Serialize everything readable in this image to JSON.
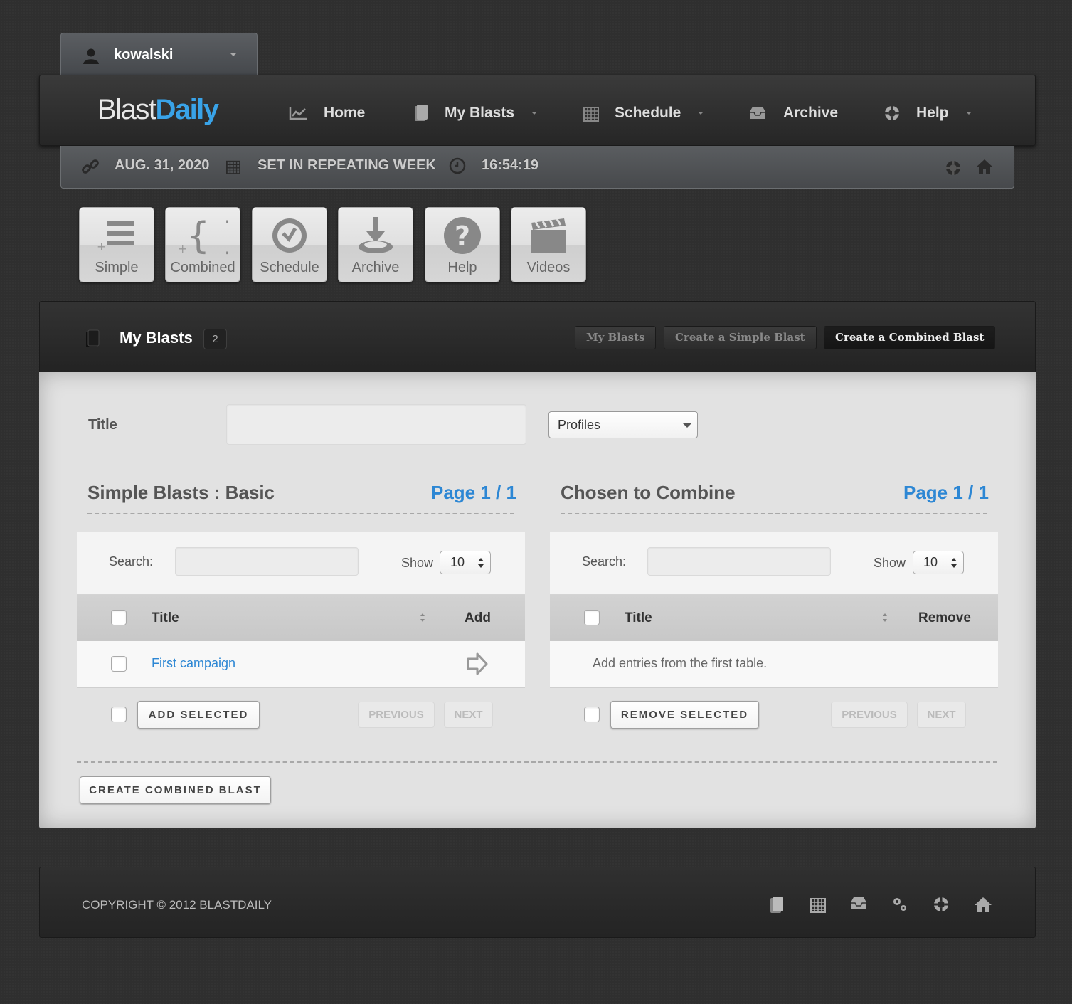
{
  "user": {
    "name": "kowalski"
  },
  "brand": {
    "part1": "Blast",
    "part2": "Daily",
    "accent": "#39a3e8"
  },
  "nav": {
    "home": "Home",
    "my_blasts": "My Blasts",
    "schedule": "Schedule",
    "archive": "Archive",
    "help": "Help"
  },
  "infobar": {
    "date": "AUG. 31, 2020",
    "week": "SET IN REPEATING WEEK",
    "time": "16:54:19"
  },
  "quick": {
    "simple": "Simple",
    "combined": "Combined",
    "schedule": "Schedule",
    "archive": "Archive",
    "help": "Help",
    "videos": "Videos"
  },
  "panel": {
    "title": "My Blasts",
    "count": "2",
    "btn_my_blasts": "My Blasts",
    "btn_simple": "Create a Simple Blast",
    "btn_combined": "Create a Combined Blast"
  },
  "form": {
    "title_label": "Title",
    "title_value": "",
    "profiles": "Profiles"
  },
  "left_table": {
    "section": "Simple Blasts : Basic",
    "page": "Page 1 / 1",
    "search_label": "Search:",
    "show_label": "Show",
    "show_value": "10",
    "col_title": "Title",
    "col_action": "Add",
    "rows": [
      {
        "title": "First campaign"
      }
    ],
    "action_button": "ADD SELECTED",
    "prev": "PREVIOUS",
    "next": "NEXT"
  },
  "right_table": {
    "section": "Chosen to Combine",
    "page": "Page 1 / 1",
    "search_label": "Search:",
    "show_label": "Show",
    "show_value": "10",
    "col_title": "Title",
    "col_action": "Remove",
    "empty": "Add entries from the first table.",
    "action_button": "REMOVE SELECTED",
    "prev": "PREVIOUS",
    "next": "NEXT"
  },
  "create_button": "CREATE COMBINED BLAST",
  "footer": {
    "copyright": "COPYRIGHT © 2012 BLASTDAILY"
  },
  "colors": {
    "link": "#2d87d4",
    "dark_bar": "#2a2a2a",
    "body_bg": "#2f2f2f"
  }
}
